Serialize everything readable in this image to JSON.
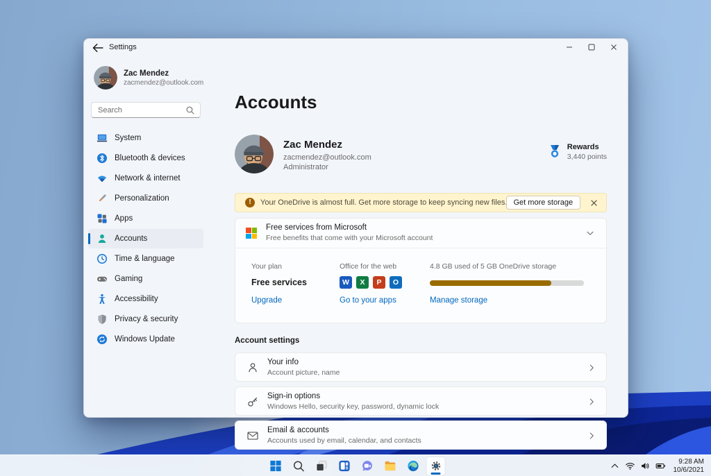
{
  "window": {
    "title": "Settings"
  },
  "sidebar": {
    "user": {
      "name": "Zac Mendez",
      "email": "zacmendez@outlook.com"
    },
    "search": {
      "placeholder": "Search"
    },
    "items": [
      {
        "label": "System",
        "icon": "system",
        "selected": false
      },
      {
        "label": "Bluetooth & devices",
        "icon": "bluetooth",
        "selected": false
      },
      {
        "label": "Network & internet",
        "icon": "network",
        "selected": false
      },
      {
        "label": "Personalization",
        "icon": "personalization",
        "selected": false
      },
      {
        "label": "Apps",
        "icon": "apps",
        "selected": false
      },
      {
        "label": "Accounts",
        "icon": "accounts",
        "selected": true
      },
      {
        "label": "Time & language",
        "icon": "time",
        "selected": false
      },
      {
        "label": "Gaming",
        "icon": "gaming",
        "selected": false
      },
      {
        "label": "Accessibility",
        "icon": "accessibility",
        "selected": false
      },
      {
        "label": "Privacy & security",
        "icon": "privacy",
        "selected": false
      },
      {
        "label": "Windows Update",
        "icon": "update",
        "selected": false
      }
    ]
  },
  "main": {
    "page_title": "Accounts",
    "profile": {
      "name": "Zac Mendez",
      "email": "zacmendez@outlook.com",
      "role": "Administrator"
    },
    "rewards": {
      "label": "Rewards",
      "points": "3,440 points"
    },
    "banner": {
      "text": "Your OneDrive is almost full. Get more storage to keep syncing new files.",
      "button": "Get more storage"
    },
    "free_services": {
      "title": "Free services from Microsoft",
      "subtitle": "Free benefits that come with your Microsoft account",
      "plan": {
        "label": "Your plan",
        "value": "Free services",
        "link": "Upgrade"
      },
      "office": {
        "label": "Office for the web",
        "link": "Go to your apps",
        "apps": [
          {
            "name": "Word",
            "letter": "W",
            "color": "#185abd"
          },
          {
            "name": "Excel",
            "letter": "X",
            "color": "#107c41"
          },
          {
            "name": "PowerPoint",
            "letter": "P",
            "color": "#c43e1c"
          },
          {
            "name": "Outlook",
            "letter": "O",
            "color": "#0f6cbd"
          }
        ]
      },
      "storage": {
        "label": "4.8 GB used of 5 GB OneDrive storage",
        "link": "Manage storage",
        "percent": 79,
        "fill_color": "#9a6c00"
      }
    },
    "account_settings": {
      "heading": "Account settings",
      "rows": [
        {
          "title": "Your info",
          "subtitle": "Account picture, name",
          "icon": "person"
        },
        {
          "title": "Sign-in options",
          "subtitle": "Windows Hello, security key, password, dynamic lock",
          "icon": "key"
        },
        {
          "title": "Email & accounts",
          "subtitle": "Accounts used by email, calendar, and contacts",
          "icon": "mail"
        }
      ]
    }
  },
  "taskbar": {
    "icons": [
      "start",
      "search",
      "task-view",
      "widgets",
      "chat",
      "file-explorer",
      "edge",
      "settings"
    ],
    "active_icon": "settings",
    "tray": {
      "icons": [
        "chevron-up",
        "wifi",
        "volume",
        "battery"
      ],
      "time": "9:28 AM",
      "date": "10/6/2021"
    }
  },
  "colors": {
    "accent": "#0067c0",
    "banner_bg": "#fff4ce",
    "storage_fill": "#9a6c00"
  }
}
